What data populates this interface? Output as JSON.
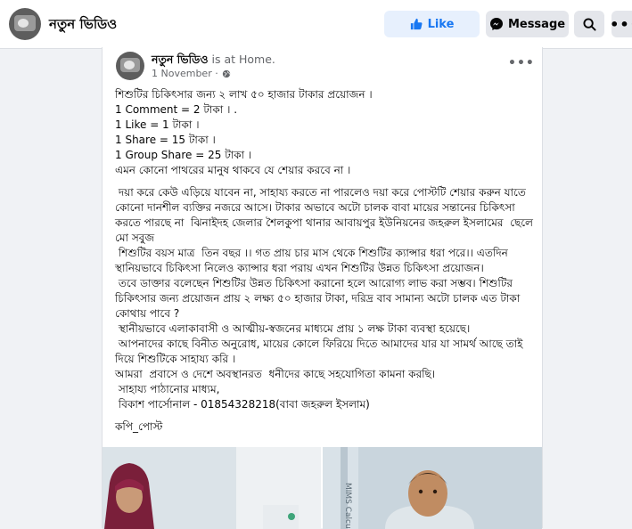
{
  "header": {
    "page_name": "নতুন ভিডিও",
    "like_label": "Like",
    "message_label": "Message",
    "search_icon": "search-icon",
    "more_icon": "more-icon",
    "more_label": "•••",
    "colors": {
      "like_bg": "#e7f0fd",
      "like_text": "#1877f2",
      "button_bg": "#e4e6eb"
    }
  },
  "post": {
    "author": "নতুন ভিডিও",
    "status": " is at Home.",
    "date": "1 November ·",
    "more_label": "•••",
    "lines": [
      "শিশুটির চিকিৎসার জন্য ২ লাখ ৫০ হাজার টাকার প্রয়োজন ।",
      "1 Comment = 2 টাকা । .",
      "1 Like = 1 টাকা ।",
      "1 Share = 15 টাকা ।",
      "1 Group Share = 25 টাকা ।",
      "এমন কোনো পাথরের মানুষ থাকবে যে শেয়ার করবে না ।"
    ],
    "body": [
      " দয়া করে কেউ এড়িয়ে যাবেন না, সাহায্য করতে না পারলেও দয়া করে পোস্টটি শেয়ার করুন যাতে কোনো দানশীল ব্যক্তির নজরে আসে। টাকার অভাবে অটো চালক বাবা মায়ের সন্তানের চিকিৎসা করতে পারছে না  ঝিনাইদহ জেলার শৈলকুপা থানার আবায়পুর ইউনিয়নের জহরুল ইসলামের  ছেলে মো সবুজ",
      " শিশুটির বয়স মাত্র  তিন বছর ।। গত প্রায় চার মাস থেকে শিশুটির ক্যান্সার ধরা পরে।। এতদিন স্থানিয়ভাবে চিকিৎসা নিলেও ক্যান্সার ধরা পরায় এখন শিশুটির উন্নত চিকিৎসা প্রয়োজন।",
      " তবে ডাক্তার বলেছেন শিশুটির উন্নত চিকিৎসা করানো হলে আরোগ্য লাভ করা সম্ভব। শিশুটির চিকিৎসার জন্য প্রয়োজন প্রায় ২ লক্ষ্য ৫০ হাজার টাকা, দরিদ্র বাব সামান্য অটো চালক এত টাকা কোথায় পাবে ?",
      " স্থানীয়ভাবে এলাকাবাসী ও আত্মীয়-স্বজনের মাধ্যমে প্রায় ১ লক্ষ টাকা ব্যবস্থা হয়েছে।",
      " আপনাদের কাছে বিনীত অনুরোধ, মায়ের কোলে ফিরিয়ে দিতে আমাদের যার যা সামর্থ আছে তাই দিয়ে শিশুটিকে সাহায্য করি ।",
      "আমরা  প্রবাসে ও দেশে অবস্থানরত  ধনীদের কাছে সহযোগিতা কামনা করছি।",
      " সাহায্য পাঠানোর মাধ্যম,",
      " বিকাশ পার্সোনাল - 01854328218(বাবা জহরুল ইসলাম)"
    ],
    "footer_line": "কপি_পোস্ট",
    "photo_left_text": "",
    "photo_right_text": "MIMS Calcut"
  }
}
